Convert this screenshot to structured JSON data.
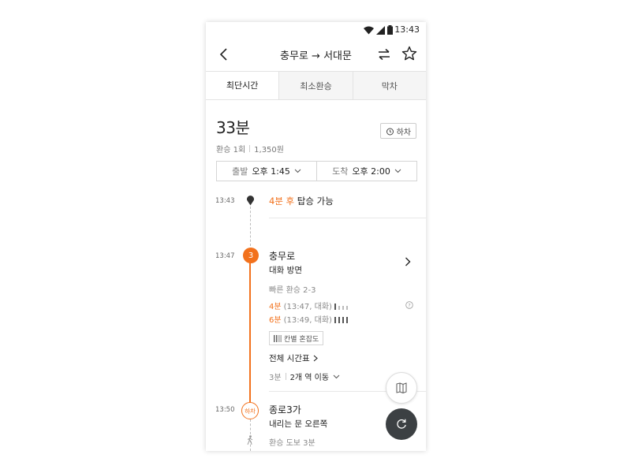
{
  "status": {
    "time": "13:43"
  },
  "header": {
    "title": "충무로 → 서대문"
  },
  "tabs": [
    {
      "label": "최단시간",
      "active": true
    },
    {
      "label": "최소환승",
      "active": false
    },
    {
      "label": "막차",
      "active": false
    }
  ],
  "summary": {
    "duration": "33분",
    "transfers": "환승 1회",
    "fare": "1,350원",
    "alarm_label": "하차"
  },
  "time_select": {
    "depart_label": "출발",
    "depart_value": "오후 1:45",
    "arrive_label": "도착",
    "arrive_value": "오후 2:00"
  },
  "timeline": {
    "start": {
      "time": "13:43",
      "minutes": "4분 후",
      "text": "탑승 가능"
    },
    "board": {
      "time": "13:47",
      "line_badge": "3",
      "station": "충무로",
      "direction": "대화 방면",
      "quick_transfer": "빠른 환승 2-3",
      "arrivals": [
        {
          "minutes": "4분",
          "detail": "(13:47, 대화)"
        },
        {
          "minutes": "6분",
          "detail": "(13:49, 대화)"
        }
      ],
      "congestion_label": "칸별 혼잡도",
      "timetable_link": "전체 시간표",
      "ride_minutes": "3분",
      "stops": "2개 역 이동"
    },
    "alight": {
      "time": "13:50",
      "badge": "하차",
      "station": "종로3가",
      "door": "내리는 문 오른쪽",
      "walk": "환승 도보 3분"
    }
  },
  "colors": {
    "accent": "#f2711c",
    "fab_dark": "#3c4043"
  }
}
